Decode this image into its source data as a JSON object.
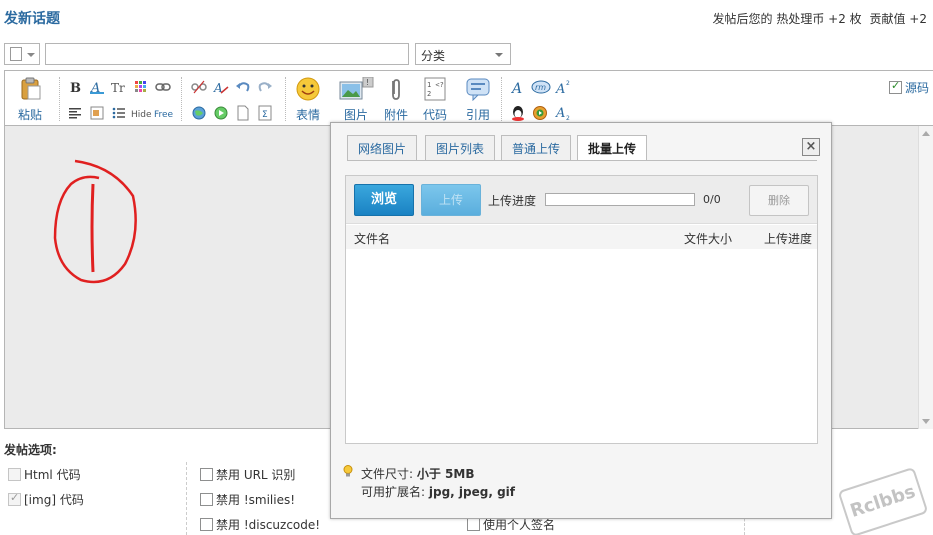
{
  "header": {
    "title": "发新话题",
    "reward_text": "发帖后您的 热处理币 +2 枚",
    "contribution_text": "贡献值 +2"
  },
  "subject": {
    "category_label": "分类"
  },
  "toolbar": {
    "paste": "粘贴",
    "emoticon": "表情",
    "image": "图片",
    "attachment": "附件",
    "code": "代码",
    "quote": "引用",
    "source": "源码"
  },
  "options": {
    "title": "发帖选项:",
    "html_code": "Html 代码",
    "img_code": "[img] 代码",
    "disable_url": "禁用 URL 识别",
    "disable_smilies": "禁用 !smilies!",
    "disable_discuzcode": "禁用 !discuzcode!",
    "use_signature": "使用个人签名"
  },
  "dialog": {
    "tabs": [
      "网络图片",
      "图片列表",
      "普通上传",
      "批量上传"
    ],
    "active_tab": 3,
    "close": "×",
    "browse": "浏览",
    "upload": "上传",
    "progress_label": "上传进度",
    "progress_count": "0/0",
    "progress_value": 0,
    "delete": "删除",
    "col_filename": "文件名",
    "col_filesize": "文件大小",
    "col_progress": "上传进度",
    "tip_size_label": "文件尺寸:",
    "tip_size_value": "小于 5MB",
    "tip_ext_label": "可用扩展名:",
    "tip_ext_value": "jpg, jpeg, gif"
  },
  "watermark": "Rclbbs",
  "colors": {
    "link_blue": "#2b6aa0",
    "button_blue": "#1a82c3",
    "annotation_red": "#e02020"
  }
}
